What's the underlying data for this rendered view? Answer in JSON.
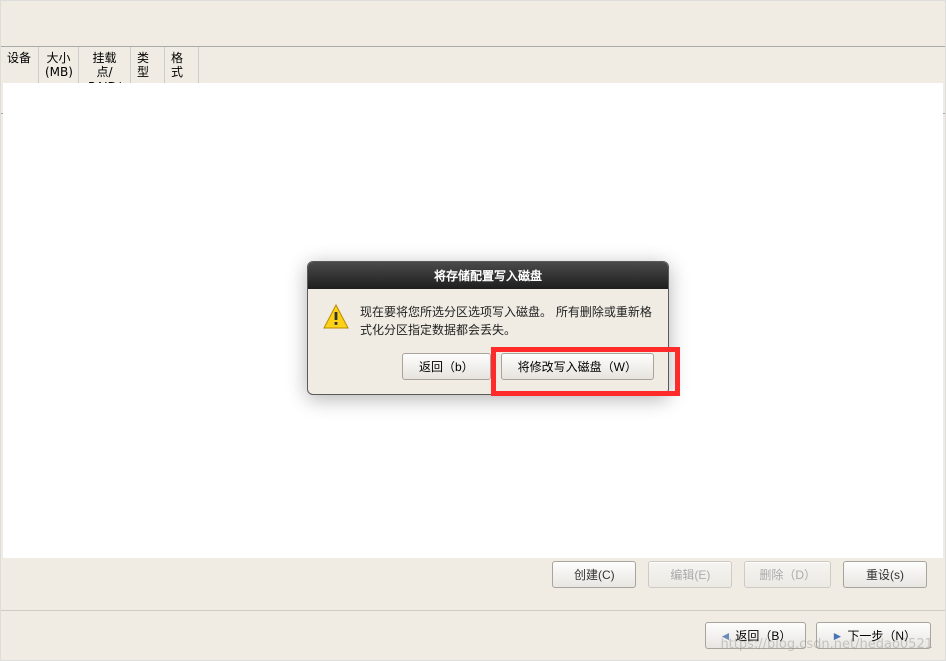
{
  "columns": {
    "device": "设备",
    "size": "大小\n(MB)",
    "mount": "挂载点/\nRAID/卷",
    "type": "类型",
    "format": "格式"
  },
  "dialog": {
    "title": "将存储配置写入磁盘",
    "message": "现在要将您所选分区选项写入磁盘。 所有删除或重新格式化分区指定数据都会丢失。",
    "back_btn": "返回（b）",
    "write_btn": "将修改写入磁盘（W）"
  },
  "buttons": {
    "create": "创建(C)",
    "edit": "编辑(E)",
    "delete": "删除（D）",
    "reset": "重设(s)",
    "back": "返回（B）",
    "next": "下一步（N）"
  },
  "watermark": "https://blog.csdn.net/hedao0521"
}
